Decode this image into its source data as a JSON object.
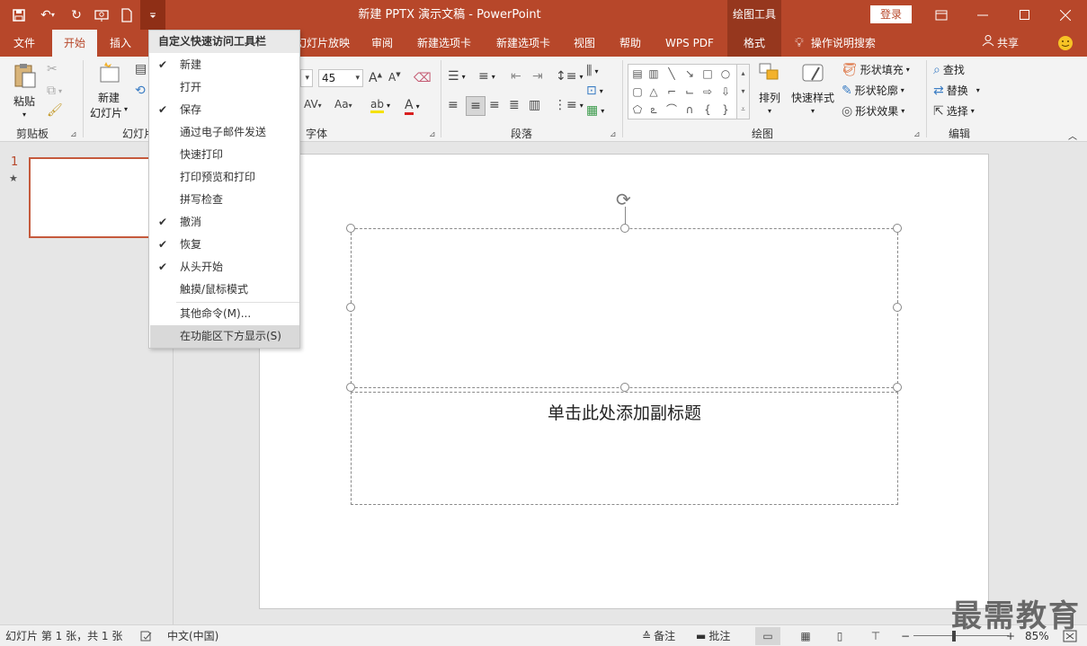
{
  "window": {
    "title": "新建 PPTX 演示文稿  -  PowerPoint",
    "context_tool": "绘图工具",
    "login_label": "登录"
  },
  "tabs": [
    {
      "label": "文件"
    },
    {
      "label": "开始"
    },
    {
      "label": "插入"
    },
    {
      "label": "幻灯片放映"
    },
    {
      "label": "审阅"
    },
    {
      "label": "新建选项卡"
    },
    {
      "label": "新建选项卡"
    },
    {
      "label": "视图"
    },
    {
      "label": "帮助"
    },
    {
      "label": "WPS PDF"
    },
    {
      "label": "格式"
    }
  ],
  "tellme": "操作说明搜索",
  "share": "共享",
  "ribbon": {
    "clipboard": {
      "paste": "粘贴",
      "label": "剪贴板"
    },
    "slides": {
      "new_slide_1": "新建",
      "new_slide_2": "幻灯片",
      "label": "幻灯片"
    },
    "font": {
      "size": "45",
      "label": "字体"
    },
    "paragraph": {
      "label": "段落"
    },
    "drawing": {
      "arrange": "排列",
      "quick_styles": "快速样式",
      "shape_fill": "形状填充",
      "shape_outline": "形状轮廓",
      "shape_effects": "形状效果",
      "label": "绘图"
    },
    "editing": {
      "find": "查找",
      "replace": "替换",
      "select": "选择",
      "label": "编辑"
    }
  },
  "qat_menu": {
    "header": "自定义快速访问工具栏",
    "items": [
      {
        "label": "新建",
        "checked": true
      },
      {
        "label": "打开",
        "checked": false
      },
      {
        "label": "保存",
        "checked": true
      },
      {
        "label": "通过电子邮件发送",
        "checked": false
      },
      {
        "label": "快速打印",
        "checked": false
      },
      {
        "label": "打印预览和打印",
        "checked": false
      },
      {
        "label": "拼写检查",
        "checked": false
      },
      {
        "label": "撤消",
        "checked": true
      },
      {
        "label": "恢复",
        "checked": true
      },
      {
        "label": "从头开始",
        "checked": true
      },
      {
        "label": "触摸/鼠标模式",
        "checked": false
      }
    ],
    "more_commands": "其他命令(M)...",
    "show_below": "在功能区下方显示(S)"
  },
  "thumbnails": {
    "number": "1",
    "star": "★"
  },
  "slide": {
    "subtitle_placeholder": "单击此处添加副标题"
  },
  "status": {
    "slide_info": "幻灯片 第 1 张，共 1 张",
    "language": "中文(中国)",
    "notes": "备注",
    "comments": "批注",
    "zoom": "85%",
    "zoom_level": 0.42
  },
  "watermark": "最需教育",
  "colors": {
    "accent": "#b7472a"
  }
}
